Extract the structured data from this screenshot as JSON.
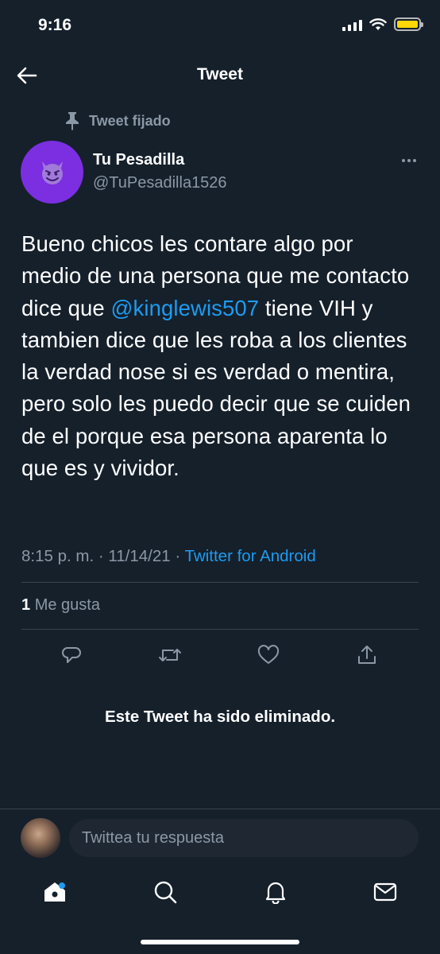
{
  "status_bar": {
    "time": "9:16",
    "battery_color": "#ffd60a"
  },
  "header": {
    "title": "Tweet",
    "back_icon": "arrow-left-icon"
  },
  "pinned": {
    "label": "Tweet fijado",
    "icon": "pin-icon"
  },
  "author": {
    "name": "Tu Pesadilla",
    "handle": "@TuPesadilla1526",
    "avatar_emoji": "😈"
  },
  "tweet": {
    "text_before": "Bueno chicos les contare algo por medio de una persona que me contacto dice que ",
    "mention": "@kinglewis507",
    "text_after": " tiene VIH y tambien dice que les roba a los clientes la verdad nose si es verdad o mentira, pero solo les puedo decir que se cuiden de el porque esa persona aparenta lo que es y vividor."
  },
  "meta": {
    "time": "8:15 p. m.",
    "separator": " · ",
    "date": "11/14/21",
    "source": "Twitter for Android"
  },
  "likes": {
    "count": "1",
    "label": "Me gusta"
  },
  "actions": [
    "reply-icon",
    "retweet-icon",
    "like-icon",
    "share-icon"
  ],
  "deleted_notice": "Este Tweet ha sido eliminado.",
  "reply": {
    "placeholder": "Twittea tu respuesta"
  },
  "nav": [
    "home-icon",
    "search-icon",
    "notifications-icon",
    "messages-icon"
  ],
  "colors": {
    "background": "#15202b",
    "accent": "#1d9bf0",
    "muted": "#8b98a5",
    "avatar_bg": "#7b2fe0"
  }
}
